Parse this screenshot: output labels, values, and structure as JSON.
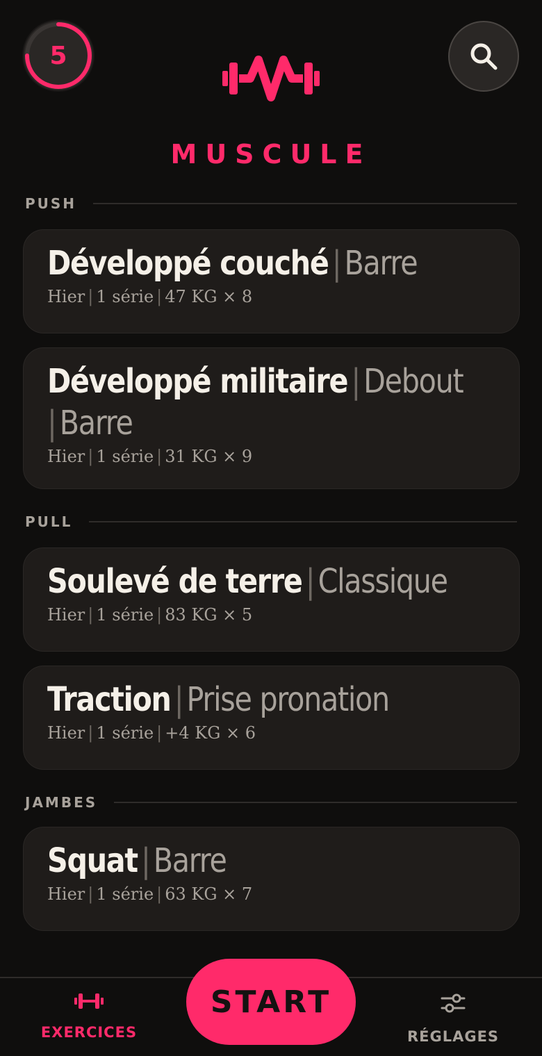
{
  "header": {
    "streak_count": "5",
    "app_title": "MUSCULE"
  },
  "sections": [
    {
      "label": "PUSH",
      "exercises": [
        {
          "name": "Développé couché",
          "variant": "Barre",
          "when": "Hier",
          "sets": "1 série",
          "last": "47 KG × 8"
        },
        {
          "name": "Développé militaire",
          "variant": "Debout",
          "variant2": "Barre",
          "when": "Hier",
          "sets": "1 série",
          "last": "31 KG × 9"
        }
      ]
    },
    {
      "label": "PULL",
      "exercises": [
        {
          "name": "Soulevé de terre",
          "variant": "Classique",
          "when": "Hier",
          "sets": "1 série",
          "last": "83 KG × 5"
        },
        {
          "name": "Traction",
          "variant": "Prise pronation",
          "when": "Hier",
          "sets": "1 série",
          "last": "+4 KG × 6"
        }
      ]
    },
    {
      "label": "JAMBES",
      "exercises": [
        {
          "name": "Squat",
          "variant": "Barre",
          "when": "Hier",
          "sets": "1 série",
          "last": "63 KG × 7"
        }
      ]
    }
  ],
  "nav": {
    "exercises_label": "EXERCICES",
    "start_label": "START",
    "settings_label": "RÉGLAGES"
  },
  "colors": {
    "accent": "#ff2a6a",
    "background": "#0f0e0d",
    "card": "#1f1c1a",
    "muted": "#a8a29b"
  },
  "icons": {
    "search": "search-icon",
    "logo": "dumbbell-logo-icon",
    "exercises": "dumbbell-icon",
    "settings": "sliders-icon"
  }
}
